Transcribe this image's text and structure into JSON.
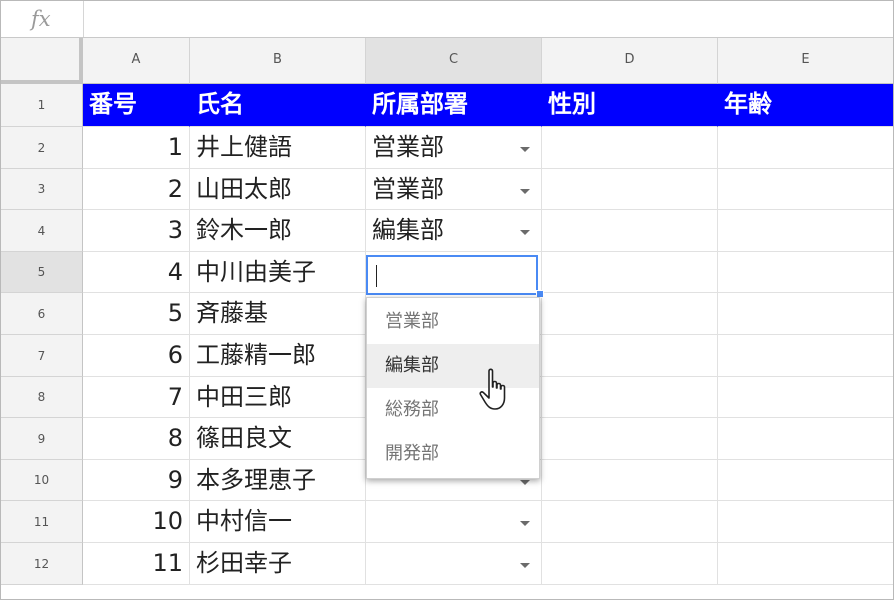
{
  "formula_bar": {
    "fx_label": "fx",
    "value": ""
  },
  "columns": [
    "A",
    "B",
    "C",
    "D",
    "E"
  ],
  "header_row": {
    "row": "1",
    "cells": [
      "番号",
      "氏名",
      "所属部署",
      "性別",
      "年齢"
    ]
  },
  "rows": [
    {
      "row": "2",
      "num": "1",
      "name": "井上健語",
      "dept": "営業部"
    },
    {
      "row": "3",
      "num": "2",
      "name": "山田太郎",
      "dept": "営業部"
    },
    {
      "row": "4",
      "num": "3",
      "name": "鈴木一郎",
      "dept": "編集部"
    },
    {
      "row": "5",
      "num": "4",
      "name": "中川由美子",
      "dept": ""
    },
    {
      "row": "6",
      "num": "5",
      "name": "斉藤基",
      "dept": ""
    },
    {
      "row": "7",
      "num": "6",
      "name": "工藤精一郎",
      "dept": ""
    },
    {
      "row": "8",
      "num": "7",
      "name": "中田三郎",
      "dept": ""
    },
    {
      "row": "9",
      "num": "8",
      "name": "篠田良文",
      "dept": ""
    },
    {
      "row": "10",
      "num": "9",
      "name": "本多理恵子",
      "dept": ""
    },
    {
      "row": "11",
      "num": "10",
      "name": "中村信一",
      "dept": ""
    },
    {
      "row": "12",
      "num": "11",
      "name": "杉田幸子",
      "dept": ""
    }
  ],
  "active_cell": {
    "ref": "C5",
    "value": ""
  },
  "dropdown": {
    "options": [
      "営業部",
      "編集部",
      "総務部",
      "開発部"
    ],
    "hovered": "編集部"
  },
  "colors": {
    "header_fill": "#0000ff",
    "header_text": "#ffffff",
    "selection": "#4a8af4"
  }
}
